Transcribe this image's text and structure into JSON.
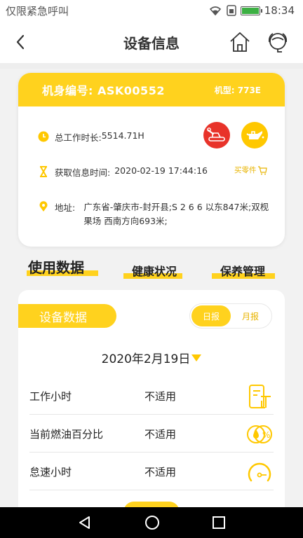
{
  "status_bar": {
    "carrier": "仅限紧急呼叫",
    "time": "18:34"
  },
  "header": {
    "title": "设备信息",
    "back_icon": "chevron-left-icon",
    "home_icon": "home-icon",
    "service_icon": "customer-service-icon"
  },
  "machine": {
    "serial_label": "机身编号:",
    "serial": "ASK00552",
    "model_label": "机型:",
    "model": "773E",
    "work_hours_label": "总工作时长:",
    "work_hours": "5514.71H",
    "fetch_time_label": "获取信息时间:",
    "fetch_time": "2020-02-19 17:44:16",
    "address_label": "地址:",
    "address": "广东省-肇庆市-封开县;S 2 6 6 以东847米;双枧果场 西南方向693米;",
    "buy_parts": "买零件",
    "accent_color": "#ffd21e",
    "repair_color": "#e8332a"
  },
  "tabs": [
    {
      "label": "使用数据",
      "active": true
    },
    {
      "label": "健康状况",
      "active": false
    },
    {
      "label": "保养管理",
      "active": false
    }
  ],
  "panel": {
    "title": "设备数据",
    "toggle": {
      "daily": "日报",
      "monthly": "月报",
      "selected": "日报"
    },
    "date": "2020年2月19日",
    "rows": [
      {
        "label": "工作小时",
        "value": "不适用",
        "icon": "hours-icon"
      },
      {
        "label": "当前燃油百分比",
        "value": "不适用",
        "icon": "fuel-percent-icon"
      },
      {
        "label": "怠速小时",
        "value": "不适用",
        "icon": "gauge-icon"
      }
    ]
  }
}
